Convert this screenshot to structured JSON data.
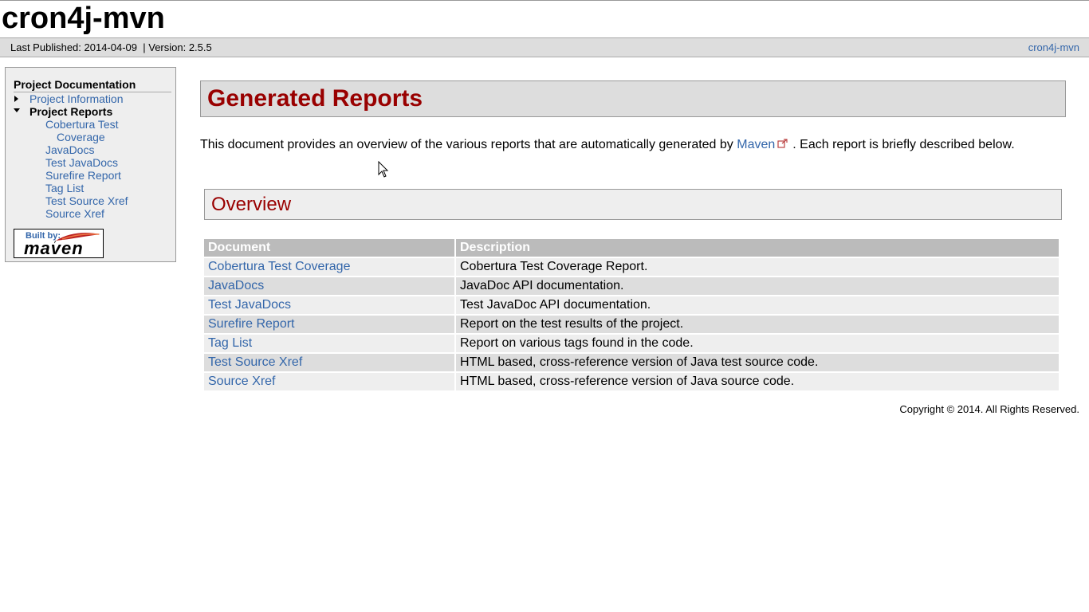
{
  "site": {
    "title": "cron4j-mvn"
  },
  "breadcrumbs": {
    "published": "Last Published: 2014-04-09",
    "version": "| Version: 2.5.5",
    "right_link": "cron4j-mvn"
  },
  "nav": {
    "title": "Project Documentation",
    "project_information": "Project Information",
    "project_reports": "Project Reports",
    "items": [
      {
        "label_line1": "Cobertura Test",
        "label_line2": "Coverage"
      },
      {
        "label": "JavaDocs"
      },
      {
        "label": "Test JavaDocs"
      },
      {
        "label": "Surefire Report"
      },
      {
        "label": "Tag List"
      },
      {
        "label": "Test Source Xref"
      },
      {
        "label": "Source Xref"
      }
    ],
    "badge_built": "Built by:",
    "badge_maven": "maven"
  },
  "main": {
    "heading": "Generated Reports",
    "intro_before": "This document provides an overview of the various reports that are automatically generated by",
    "intro_link": "Maven",
    "intro_after": ". Each report is briefly described below.",
    "section_heading": "Overview",
    "table": {
      "headers": [
        "Document",
        "Description"
      ],
      "rows": [
        {
          "document": "Cobertura Test Coverage",
          "description": "Cobertura Test Coverage Report."
        },
        {
          "document": "JavaDocs",
          "description": "JavaDoc API documentation."
        },
        {
          "document": "Test JavaDocs",
          "description": "Test JavaDoc API documentation."
        },
        {
          "document": "Surefire Report",
          "description": "Report on the test results of the project."
        },
        {
          "document": "Tag List",
          "description": "Report on various tags found in the code."
        },
        {
          "document": "Test Source Xref",
          "description": "HTML based, cross-reference version of Java test source code."
        },
        {
          "document": "Source Xref",
          "description": "HTML based, cross-reference version of Java source code."
        }
      ]
    }
  },
  "footer": {
    "copyright": "Copyright © 2014. All Rights Reserved."
  },
  "colors": {
    "link": "#3366aa",
    "heading": "#990000",
    "header_band": "#dddddd"
  },
  "icons": {
    "external_link": "external-link-icon",
    "cursor": "mouse-pointer-icon"
  }
}
